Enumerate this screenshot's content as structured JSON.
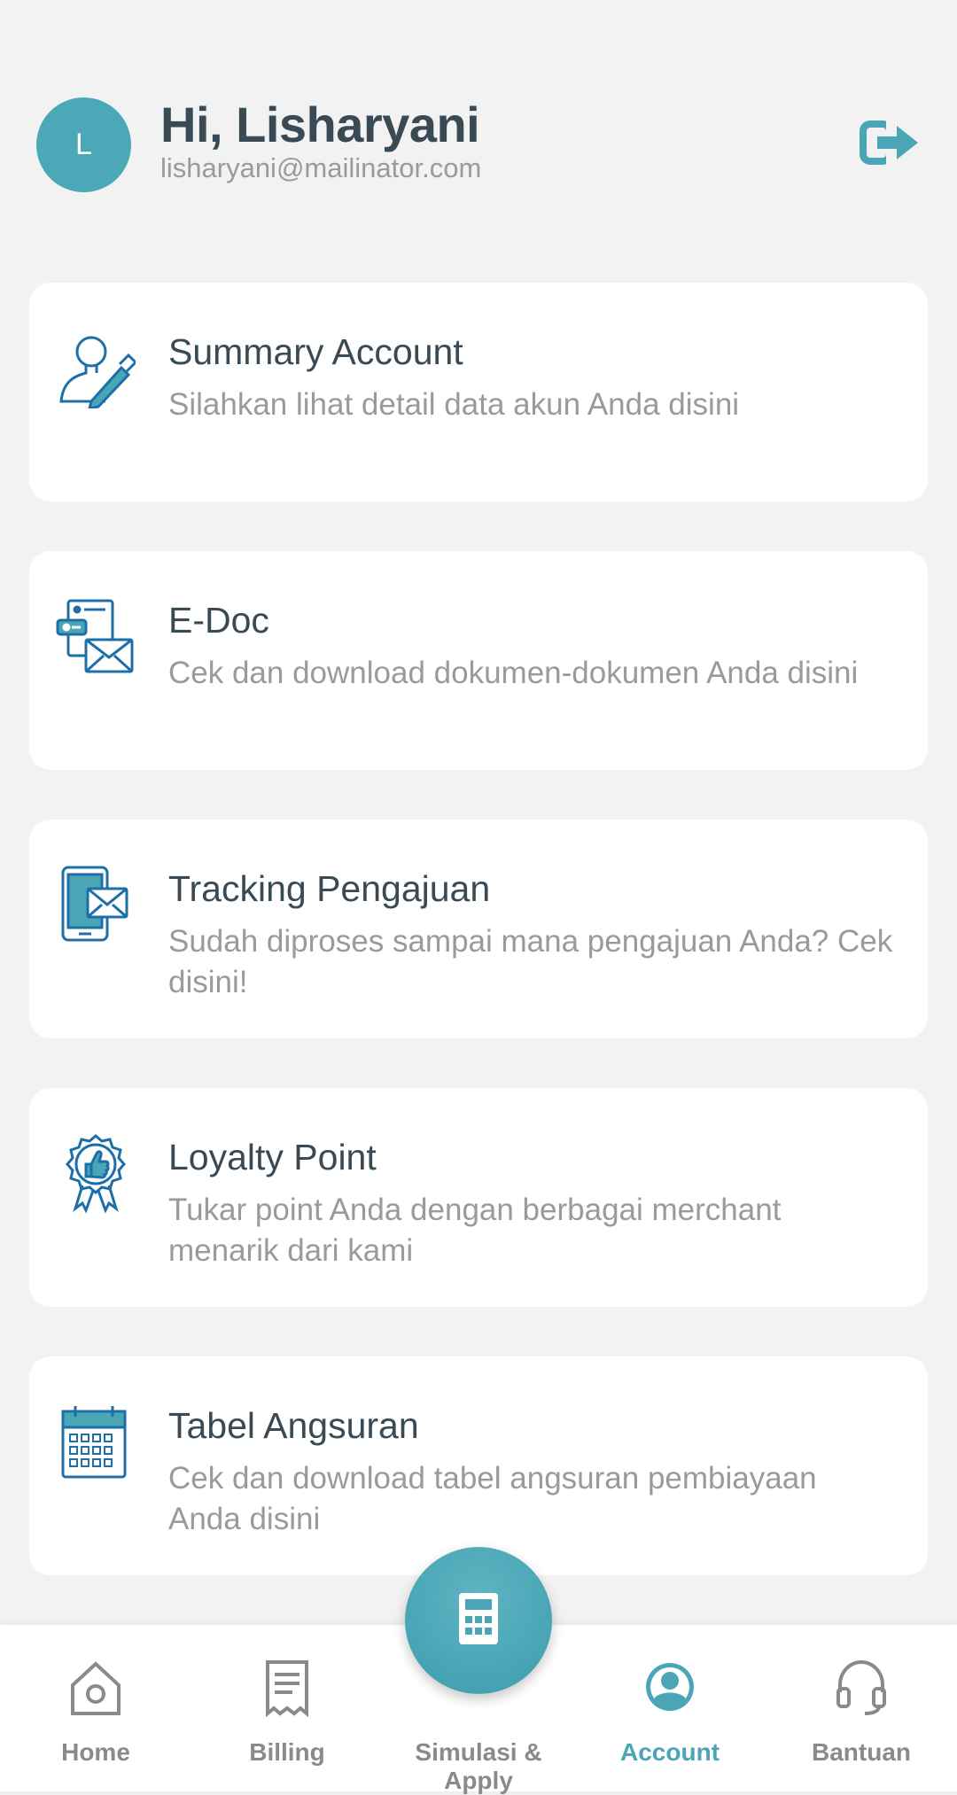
{
  "header": {
    "avatar_initial": "L",
    "greeting": "Hi, Lisharyani",
    "email": "lisharyani@mailinator.com",
    "logout_icon": "logout-icon"
  },
  "menu": [
    {
      "title": "Summary Account",
      "desc": "Silahkan lihat detail data akun Anda disini",
      "icon": "profile-edit-icon"
    },
    {
      "title": "E-Doc",
      "desc": "Cek dan download dokumen-dokumen Anda disini",
      "icon": "document-mail-icon"
    },
    {
      "title": "Tracking Pengajuan",
      "desc": "Sudah diproses sampai mana pengajuan Anda? Cek disini!",
      "icon": "phone-mail-icon"
    },
    {
      "title": "Loyalty Point",
      "desc": "Tukar point Anda dengan berbagai merchant menarik dari kami",
      "icon": "badge-thumbs-up-icon"
    },
    {
      "title": "Tabel Angsuran",
      "desc": "Cek dan download tabel angsuran pembiayaan Anda disini",
      "icon": "calendar-icon"
    }
  ],
  "nav": {
    "home": "Home",
    "billing": "Billing",
    "simulasi": "Simulasi & Apply",
    "account": "Account",
    "bantuan": "Bantuan"
  },
  "colors": {
    "accent": "#4aa6b6",
    "icon_blue": "#1d6fa8",
    "text_dark": "#394a55",
    "text_muted": "#9a9a9a",
    "background": "#f2f2f2"
  }
}
